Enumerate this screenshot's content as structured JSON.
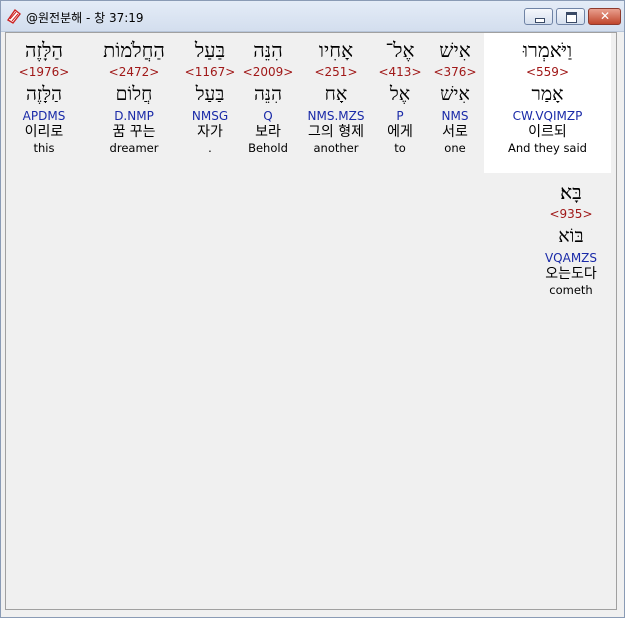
{
  "window": {
    "title": "@원전분해 - 창 37:19"
  },
  "controls": {
    "minimize": "–",
    "maximize": "□",
    "close": "✕"
  },
  "words": [
    {
      "hebrew": "הַלָּזֶה",
      "strongs": "<1976>",
      "lemma": "הַלָּזֶה",
      "parse": "APDMS",
      "korean": "이리로",
      "english": "this"
    },
    {
      "hebrew": "הַחֲלֹמוֹת",
      "strongs": "<2472>",
      "lemma": "חֲלוֹם",
      "parse": "D.NMP",
      "korean": "꿈 꾸는",
      "english": "dreamer"
    },
    {
      "hebrew": "בַּעַל",
      "strongs": "<1167>",
      "lemma": "בַּעַל",
      "parse": "NMSG",
      "korean": "자가",
      "english": "."
    },
    {
      "hebrew": "הִנֵּה",
      "strongs": "<2009>",
      "lemma": "הִנֵּה",
      "parse": "Q",
      "korean": "보라",
      "english": "Behold"
    },
    {
      "hebrew": "אָחִיו",
      "strongs": "<251>",
      "lemma": "אָח",
      "parse": "NMS.MZS",
      "korean": "그의 형제",
      "english": "another"
    },
    {
      "hebrew": "אֶל־",
      "strongs": "<413>",
      "lemma": "אֶל",
      "parse": "P",
      "korean": "에게",
      "english": "to"
    },
    {
      "hebrew": "אִישׁ",
      "strongs": "<376>",
      "lemma": "אִישׁ",
      "parse": "NMS",
      "korean": "서로",
      "english": "one"
    },
    {
      "hebrew": "וַיֹּאמְרוּ",
      "strongs": "<559>",
      "lemma": "אָמַר",
      "parse": "CW.VQIMZP",
      "korean": "이르되",
      "english": "And they said"
    },
    {
      "hebrew": "בָּא׃",
      "strongs": "<935>",
      "lemma": "בּוֹא",
      "parse": "VQAMZS",
      "korean": "오는도다",
      "english": "cometh"
    }
  ],
  "selected_word_index": 7
}
